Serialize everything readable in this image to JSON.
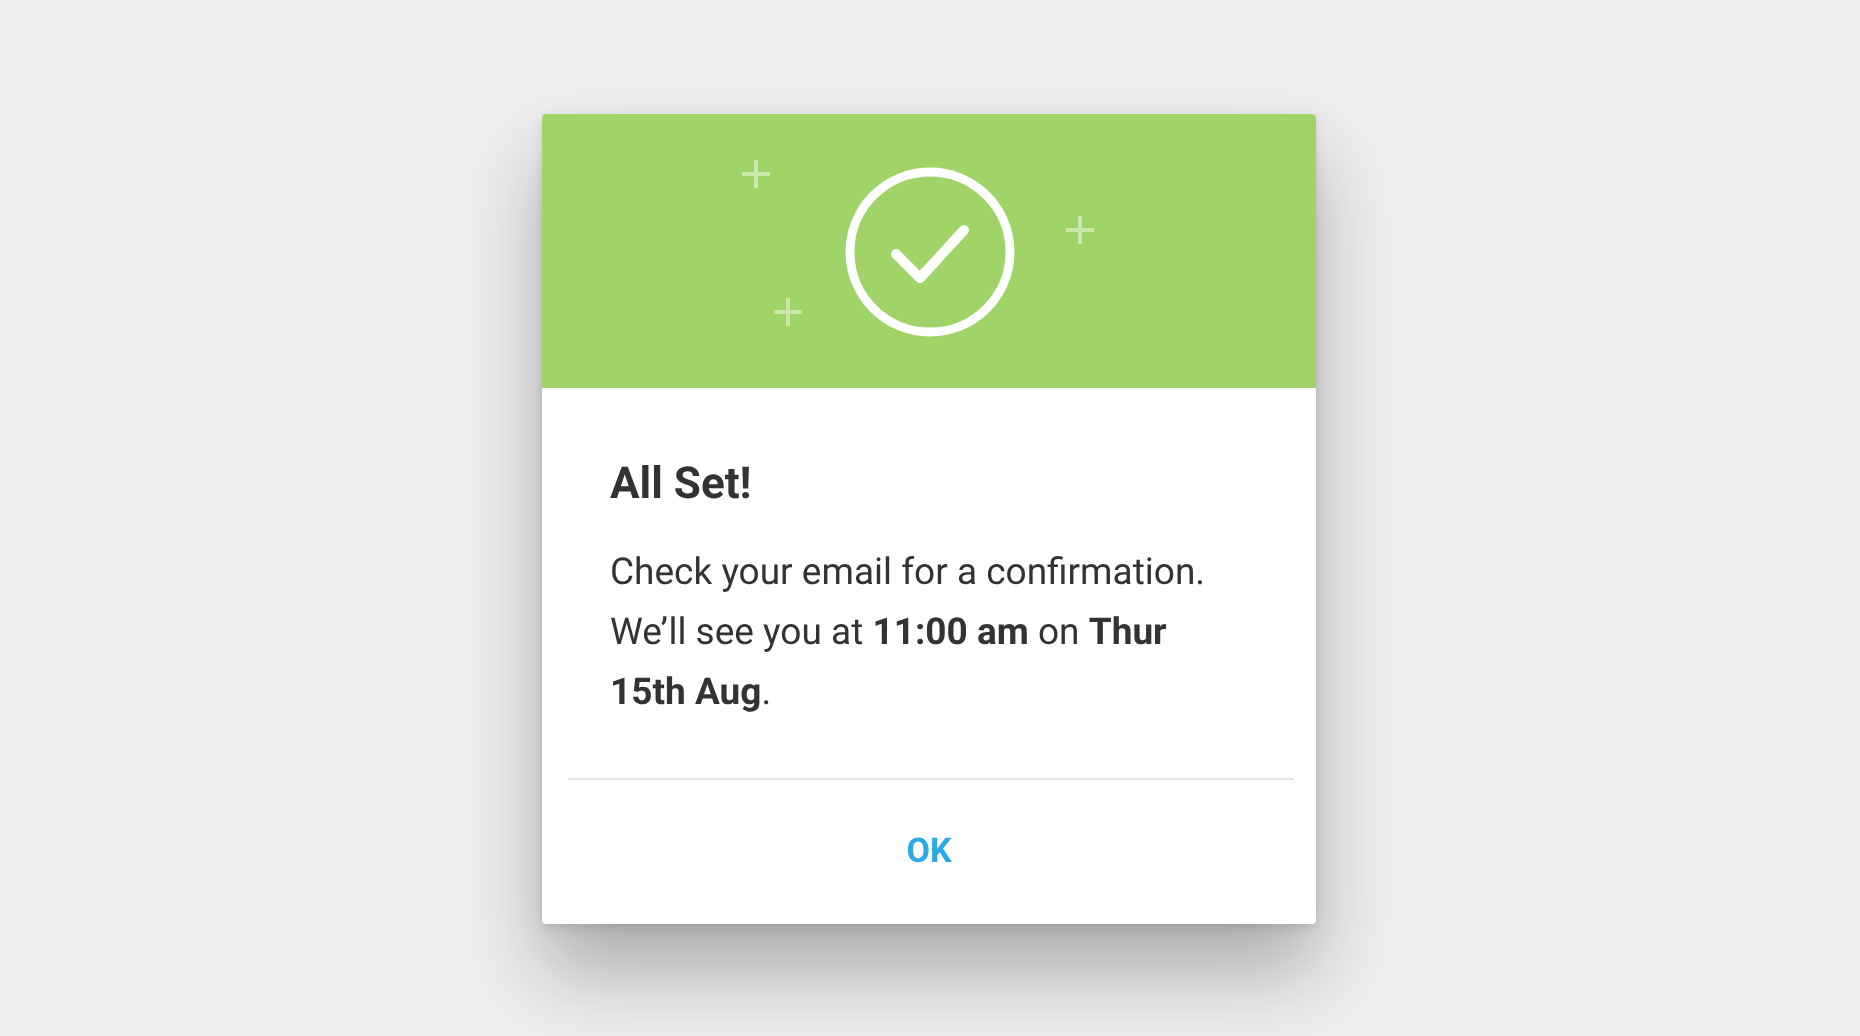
{
  "dialog": {
    "title": "All Set!",
    "message": "Check your email for a confirmation. We’ll see you at **11:00 am** on **Thur 15th Aug**.",
    "buttons": [
      "OK"
    ]
  }
}
